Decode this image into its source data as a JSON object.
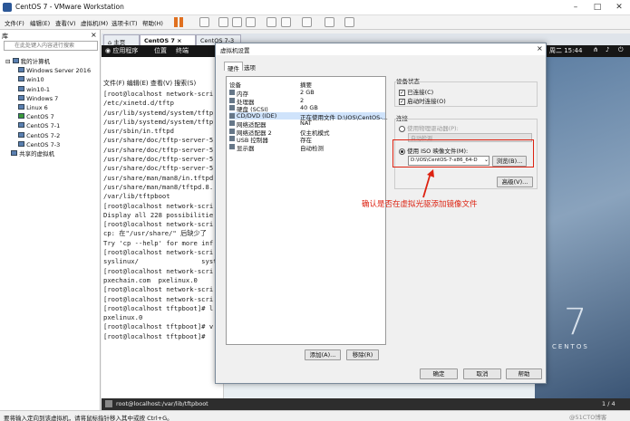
{
  "window": {
    "title": "CentOS 7 - VMware Workstation"
  },
  "menu": [
    "文件(F)",
    "编辑(E)",
    "查看(V)",
    "虚拟机(M)",
    "选项卡(T)",
    "帮助(H)"
  ],
  "library": {
    "header": "库",
    "search_placeholder": "在此处键入内容进行搜索",
    "items": [
      "我的计算机",
      "Windows Server 2016",
      "win10",
      "win10-1",
      "Windows 7",
      "Linux 6",
      "CentOS 7",
      "CentOS 7-1",
      "CentOS 7-2",
      "CentOS 7-3",
      "共享的虚拟机"
    ]
  },
  "tabs": [
    "主页",
    "CentOS 7",
    "CentOS 7-3"
  ],
  "gnome": {
    "apps": "应用程序",
    "places": "位置",
    "terminal": "终端",
    "clock": "周二 15:44"
  },
  "terminal": {
    "menu": "文件(F)  编辑(E)  查看(V)  搜索(S)",
    "lines": [
      "[root@localhost network-scri",
      "/etc/xinetd.d/tftp",
      "/usr/lib/systemd/system/tftp",
      "/usr/lib/systemd/system/tftp",
      "/usr/sbin/in.tftpd",
      "/usr/share/doc/tftp-server-5",
      "/usr/share/doc/tftp-server-5",
      "/usr/share/doc/tftp-server-5",
      "/usr/share/doc/tftp-server-5",
      "/usr/share/man/man8/in.tftpd",
      "/usr/share/man/man8/tftpd.8.",
      "/var/lib/tftpboot",
      "[root@localhost network-scri",
      "Display all 228 possibilitie",
      "[root@localhost network-scri",
      "cp: 在\"/usr/share/\" 后缺少了",
      "Try 'cp --help' for more inf",
      "[root@localhost network-scri",
      "syslinux/                syste",
      "[root@localhost network-scri",
      "pxechain.com  pxelinux.0",
      "[root@localhost network-scri",
      "[root@localhost network-scri",
      "[root@localhost tftpboot]# l",
      "pxelinux.0",
      "[root@localhost tftpboot]# v",
      "[root@localhost tftpboot]# "
    ]
  },
  "dialog": {
    "title": "虚拟机设置",
    "tabs": [
      "硬件",
      "选项"
    ],
    "col_device": "设备",
    "col_summary": "摘要",
    "devices": [
      {
        "name": "内存",
        "value": "2 GB"
      },
      {
        "name": "处理器",
        "value": "2"
      },
      {
        "name": "硬盘 (SCSI)",
        "value": "40 GB"
      },
      {
        "name": "CD/DVD (IDE)",
        "value": "正在使用文件 D:\\IOS\\CentOS-..."
      },
      {
        "name": "网络适配器",
        "value": "NAT"
      },
      {
        "name": "网络适配器 2",
        "value": "仅主机模式"
      },
      {
        "name": "USB 控制器",
        "value": "存在"
      },
      {
        "name": "显示器",
        "value": "自动检测"
      }
    ],
    "device_status": "设备状态",
    "connected": "已连接(C)",
    "connect_on_power": "启动时连接(O)",
    "connection": "连接",
    "use_physical": "使用物理驱动器(P):",
    "auto_detect": "自动检测",
    "use_iso": "使用 ISO 映像文件(M):",
    "iso_path": "D:\\IOS\\CentOS-7-x86_64-D",
    "browse": "浏览(B)...",
    "advanced": "高级(V)...",
    "add": "添加(A)...",
    "remove": "移除(R)",
    "ok": "确定",
    "cancel": "取消",
    "help": "帮助"
  },
  "annotation": "确认是否在虚拟光驱添加镜像文件",
  "desktop_brand": "CENTOS",
  "desktop_num": "7",
  "bottom_task": "root@localhost:/var/lib/tftpboot",
  "page_indicator": "1 / 4",
  "status_text": "要将输入定向到该虚拟机，请将鼠标指针移入其中或按 Ctrl+G。",
  "watermark": "@51CTO博客",
  "colors": {
    "annotation": "#d21f1f",
    "titlebar_icon": "#2b5797"
  }
}
